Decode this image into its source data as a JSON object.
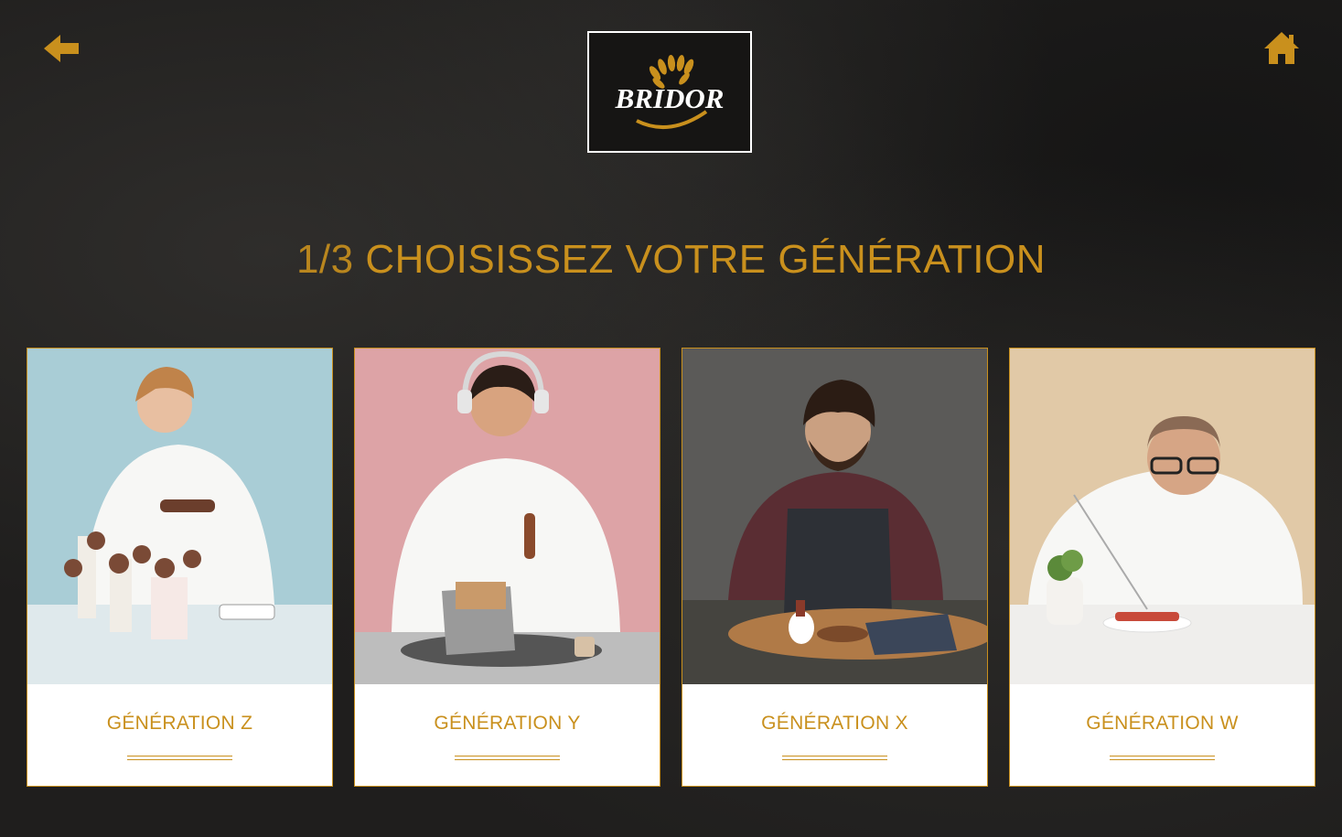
{
  "header": {
    "back_icon": "arrow-left-icon",
    "home_icon": "home-icon",
    "logo_text": "BRIDOR",
    "accent_color": "#c9901d"
  },
  "title": {
    "step": "1/3",
    "text": "CHOISISSEZ VOTRE GÉNÉRATION"
  },
  "cards": [
    {
      "label": "GÉNÉRATION Z",
      "photo_bg": "#a9cdd6",
      "floor": "#dfe9ec"
    },
    {
      "label": "GÉNÉRATION Y",
      "photo_bg": "#dda3a6",
      "floor": "#bdbdbd"
    },
    {
      "label": "GÉNÉRATION X",
      "photo_bg": "#5b5a58",
      "floor": "#45443f"
    },
    {
      "label": "GÉNÉRATION W",
      "photo_bg": "#e1c9a7",
      "floor": "#efeeec"
    }
  ]
}
